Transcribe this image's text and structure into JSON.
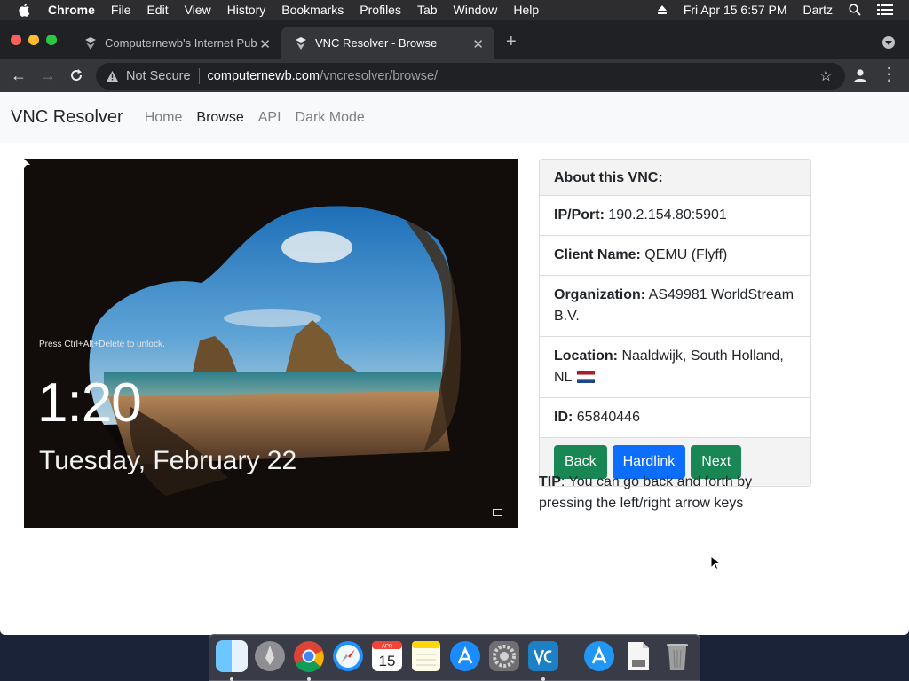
{
  "menubar": {
    "app_name": "Chrome",
    "menus": [
      "File",
      "Edit",
      "View",
      "History",
      "Bookmarks",
      "Profiles",
      "Tab",
      "Window",
      "Help"
    ],
    "datetime": "Fri Apr 15  6:57 PM",
    "user": "Dartz"
  },
  "browser": {
    "tabs": [
      {
        "title": "Computernewb's Internet Pub",
        "active": false
      },
      {
        "title": "VNC Resolver - Browse",
        "active": true
      }
    ],
    "omnibox": {
      "security": "Not Secure",
      "host": "computernewb.com",
      "path": "/vncresolver/browse/"
    }
  },
  "site": {
    "brand": "VNC Resolver",
    "nav": [
      {
        "label": "Home",
        "active": false
      },
      {
        "label": "Browse",
        "active": true
      },
      {
        "label": "API",
        "active": false
      },
      {
        "label": "Dark Mode",
        "active": false
      }
    ]
  },
  "vnc_screenshot": {
    "unlock_hint": "Press Ctrl+Alt+Delete to unlock.",
    "time": "1:20",
    "date": "Tuesday, February 22"
  },
  "info_card": {
    "header": "About this VNC:",
    "ip_label": "IP/Port:",
    "ip_value": "190.2.154.80:5901",
    "client_label": "Client Name:",
    "client_value": "QEMU (Flyff)",
    "org_label": "Organization:",
    "org_value": "AS49981 WorldStream B.V.",
    "location_label": "Location:",
    "location_value": "Naaldwijk, South Holland, NL",
    "id_label": "ID:",
    "id_value": "65840446",
    "buttons": {
      "back": "Back",
      "hardlink": "Hardlink",
      "next": "Next"
    }
  },
  "tip": {
    "label": "TIP",
    "text": ": You can go back and forth by pressing the left/right arrow keys"
  },
  "dock": {
    "apps": [
      "finder-icon",
      "launchpad-icon",
      "chrome-icon",
      "safari-icon",
      "calendar-icon",
      "notes-icon",
      "app-store-icon",
      "system-preferences-icon",
      "vnc-viewer-icon",
      "app-store-downloads-icon",
      "documents-icon",
      "trash-icon"
    ],
    "calendar_month": "APR",
    "calendar_day": "15"
  },
  "colors": {
    "success": "#198754",
    "primary": "#0d6efd",
    "flag_red": "#ae1c28",
    "flag_blue": "#21468b"
  }
}
